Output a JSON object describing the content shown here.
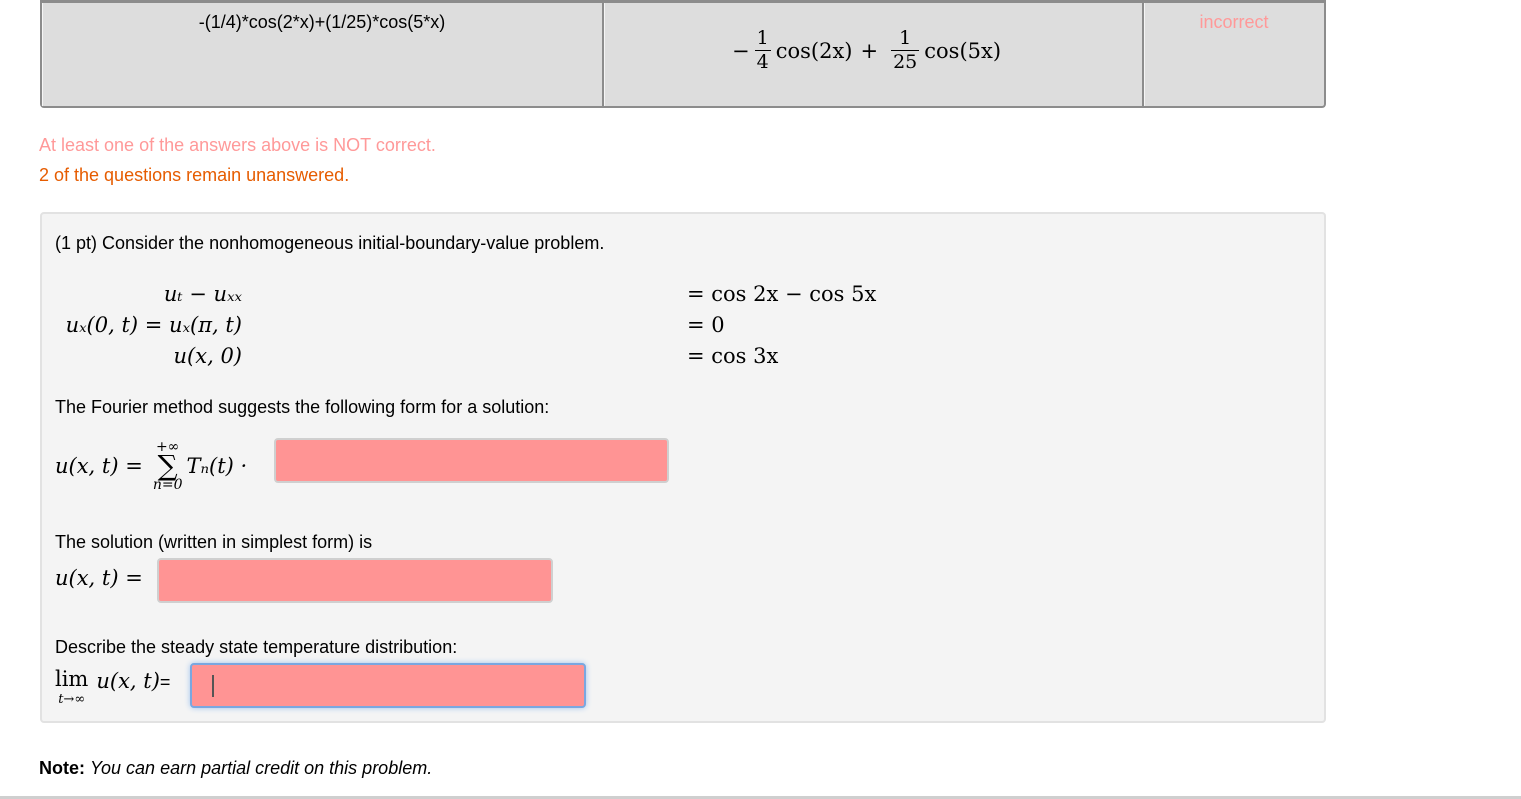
{
  "results_table": {
    "entered": "-(1/4)*cos(2*x)+(1/25)*cos(5*x)",
    "preview": {
      "sign": "−",
      "frac1": {
        "num": "1",
        "den": "4"
      },
      "term1": "cos(2x)",
      "plus": "+",
      "frac2": {
        "num": "1",
        "den": "25"
      },
      "term2": "cos(5x)"
    },
    "result": "incorrect"
  },
  "messages": {
    "not_correct": "At least one of the answers above is NOT correct.",
    "unanswered": "2 of the questions remain unanswered."
  },
  "colors": {
    "incorrect_text": "#ff9999",
    "warning_text": "#e65c00",
    "answer_field_bg": "#ff9494",
    "focus_ring": "#7aa7e0"
  },
  "problem": {
    "intro": "(1 pt) Consider the nonhomogeneous initial-boundary-value problem.",
    "system": [
      {
        "lhs": "uₜ − uₓₓ",
        "rhs": "= cos 2x − cos 5x"
      },
      {
        "lhs": "uₓ(0, t) = uₓ(π, t)",
        "rhs": "= 0"
      },
      {
        "lhs": "u(x, 0)",
        "rhs": "= cos 3x"
      }
    ],
    "fourier_prompt": "The Fourier method suggests the following form for a solution:",
    "fourier_lhs": "u(x, t) =",
    "sum_upper": "+∞",
    "sum_symbol": "∑",
    "sum_lower": "n=0",
    "sum_term": "Tₙ(t) ·",
    "answer1_value": "",
    "solution_prompt": "The solution (written in simplest form) is",
    "solution_lhs": "u(x, t) =",
    "answer2_value": "",
    "steady_prompt": "Describe the steady state temperature distribution:",
    "lim_word": "lim",
    "lim_under": "t→∞",
    "lim_expr": "u(x, t)",
    "lim_eq": "=",
    "answer3_value": ""
  },
  "note": {
    "label": "Note:",
    "text": "You can earn partial credit on this problem."
  }
}
